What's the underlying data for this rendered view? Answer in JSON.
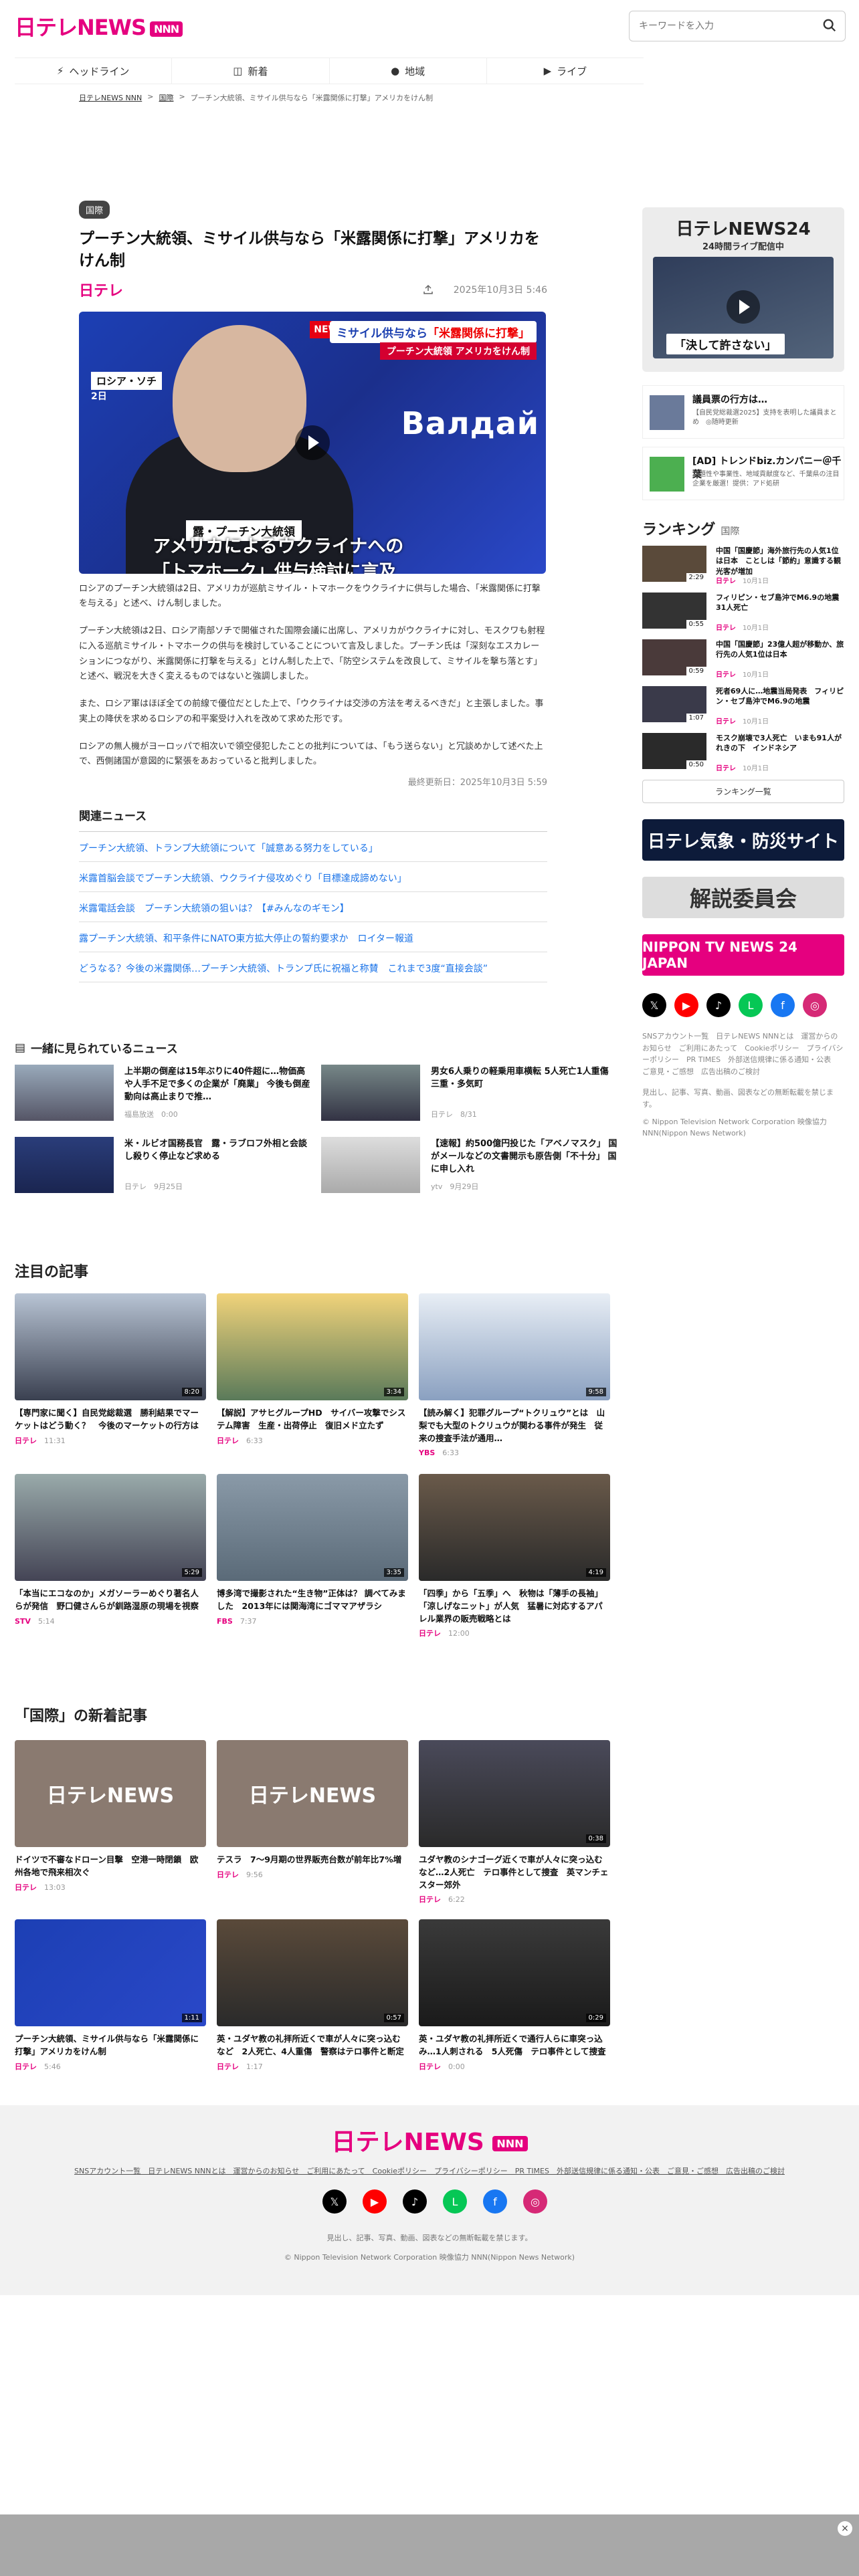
{
  "header": {
    "logo": "日テレNEWS",
    "logo_badge": "NNN",
    "search_placeholder": "キーワードを入力"
  },
  "nav": [
    {
      "label": "ヘッドライン",
      "icon": "lightning-icon"
    },
    {
      "label": "新着",
      "icon": "new-icon"
    },
    {
      "label": "地域",
      "icon": "map-pin-icon"
    },
    {
      "label": "ライブ",
      "icon": "live-icon"
    }
  ],
  "breadcrumb": [
    "日テレNEWS NNN",
    "国際",
    "プーチン大統領、ミサイル供与なら「米露関係に打撃」アメリカをけん制"
  ],
  "article": {
    "tag": "国際",
    "title": "プーチン大統領、ミサイル供与なら「米露関係に打撃」アメリカをけん制",
    "source": "日テレ",
    "date": "2025年10月3日 5:46",
    "hero": {
      "new": "NEW",
      "badge_pre": "ミサイル供与なら",
      "badge_em": "「米露関係に打撃」",
      "badge2": "プーチン大統領 アメリカをけん制",
      "place": "ロシア・ソチ",
      "day": "2日",
      "valdai": "Валдай",
      "speaker": "露・プーチン大統領",
      "cap1": "アメリカによるウクライナへの",
      "cap2": "「トマホーク」供与検討に言及"
    },
    "paragraphs": [
      "ロシアのプーチン大統領は2日、アメリカが巡航ミサイル・トマホークをウクライナに供与した場合、「米露関係に打撃を与える」と述べ、けん制しました。",
      "プーチン大統領は2日、ロシア南部ソチで開催された国際会議に出席し、アメリカがウクライナに対し、モスクワも射程に入る巡航ミサイル・トマホークの供与を検討していることについて言及しました。プーチン氏は「深刻なエスカレーションにつながり、米露関係に打撃を与える」とけん制した上で、「防空システムを改良して、ミサイルを撃ち落とす」と述べ、戦況を大きく変えるものではないと強調しました。",
      "また、ロシア軍はほぼ全ての前線で優位だとした上で、「ウクライナは交渉の方法を考えるべきだ」と主張しました。事実上の降伏を求めるロシアの和平案受け入れを改めて求めた形です。",
      "ロシアの無人機がヨーロッパで相次いで領空侵犯したことの批判については、「もう送らない」と冗談めかして述べた上で、西側諸国が意図的に緊張をあおっていると批判しました。"
    ],
    "updated": "最終更新日：2025年10月3日 5:59"
  },
  "related": {
    "heading": "関連ニュース",
    "items": [
      "プーチン大統領、トランプ大統領について「誠意ある努力をしている」",
      "米露首脳会談でプーチン大統領、ウクライナ侵攻めぐり「目標達成諦めない」",
      "米露電話会談　プーチン大統領の狙いは？【#みんなのギモン】",
      "露プーチン大統領、和平条件にNATO東方拡大停止の誓約要求か　ロイター報道",
      "どうなる？今後の米露関係…プーチン大統領、トランプ氏に祝福と称賛　これまで3度“直接会談”"
    ]
  },
  "seen": {
    "heading": "一緒に見られているニュース",
    "items": [
      {
        "title": "上半期の倒産は15年ぶりに40件超に…物価高や人手不足で多くの企業が「廃業」 今後も倒産動向は高止まりで推…",
        "source": "福島放送",
        "time": "0:00"
      },
      {
        "title": "男女6人乗りの軽乗用車横転 5人死亡1人重傷　三重・多気町",
        "source": "日テレ",
        "time": "8/31"
      },
      {
        "title": "米・ルビオ国務長官　露・ラブロフ外相と会談し殺りく停止など求める",
        "source": "日テレ",
        "time": "9月25日"
      },
      {
        "title": "【速報】約500億円投じた「アベノマスク」 国がメールなどの文書開示も原告側「不十分」 国に申し入れ",
        "source": "ytv",
        "time": "9月29日"
      }
    ]
  },
  "sidebar": {
    "live_title": "日テレNEWS24",
    "live_sub": "24時間ライブ配信中",
    "live_caption": "「決して許さない」",
    "ads": [
      {
        "title": "議員票の行方は…",
        "desc": "【自民党総裁選2025】支持を表明した議員まとめ　◎随時更新"
      },
      {
        "title": "[AD] トレンドbiz.カンパニー＠千葉",
        "desc": "話題性や事業性、地域貢献度など、千葉県の注目企業を厳選！提供：アド処研"
      }
    ],
    "ranking_heading": "ランキング",
    "ranking_tab": "国際",
    "ranking": [
      {
        "title": "中国「国慶節」海外旅行先の人気1位は日本　ことしは「節約」意識する観光客が増加",
        "src": "日テレ",
        "time": "10月1日",
        "dur": "2:29"
      },
      {
        "title": "フィリピン・セブ島沖でM6.9の地震　31人死亡",
        "src": "日テレ",
        "time": "10月1日",
        "dur": "0:55"
      },
      {
        "title": "中国「国慶節」23億人超が移動か、旅行先の人気1位は日本",
        "src": "日テレ",
        "time": "10月1日",
        "dur": "0:59"
      },
      {
        "title": "死者69人に…地震当局発表　フィリピン・セブ島沖でM6.9の地震",
        "src": "日テレ",
        "time": "10月1日",
        "dur": "1:07"
      },
      {
        "title": "モスク崩壊で3人死亡　いまも91人がれきの下　インドネシア",
        "src": "日テレ",
        "time": "10月1日",
        "dur": "0:50"
      }
    ],
    "ranking_all": "ランキング一覧",
    "banners": [
      "日テレ気象・防災サイト",
      "解説委員会",
      "NIPPON TV NEWS 24 JAPAN"
    ],
    "foot_links": "SNSアカウント一覧　日テレNEWS NNNとは　運営からのお知らせ　ご利用にあたって　Cookieポリシー　プライバシーポリシー　PR TIMES　外部送信規律に係る通知・公表　ご意見・ご感想　広告出稿のご検討",
    "foot_rights": "見出し、記事、写真、動画、図表などの無断転載を禁じます。",
    "foot_copy": "© Nippon Television Network Corporation 映像協力 NNN(Nippon News Network)"
  },
  "featured": {
    "heading": "注目の記事",
    "items": [
      {
        "title": "【専門家に聞く】自民党総裁選　勝利結果でマーケットはどう動く？　今後のマーケットの行方は",
        "source": "日テレ",
        "time": "11:31",
        "dur": "8:20"
      },
      {
        "title": "【解説】アサヒグループHD　サイバー攻撃でシステム障害　生産・出荷停止　復旧メド立たず",
        "source": "日テレ",
        "time": "6:33",
        "dur": "3:34"
      },
      {
        "title": "【読み解く】犯罪グループ“トクリュウ”とは　山梨でも大型のトクリュウが関わる事件が発生　従来の捜査手法が通用…",
        "source": "YBS",
        "time": "6:33",
        "dur": "9:58"
      },
      {
        "title": "「本当にエコなのか」メガソーラーめぐり著名人らが発信　野口健さんらが釧路湿原の現場を視察",
        "source": "STV",
        "time": "5:14",
        "dur": "5:29"
      },
      {
        "title": "博多湾で撮影された“生き物”正体は？ 調べてみました　2013年には関海湾にゴママアザラシ",
        "source": "FBS",
        "time": "7:37",
        "dur": "3:35"
      },
      {
        "title": "「四季」から「五季」へ　秋物は「薄手の長袖」「涼しげなニット」が人気　猛暑に対応するアパレル業界の販売戦略とは",
        "source": "日テレ",
        "time": "12:00",
        "dur": "4:19"
      }
    ]
  },
  "latest": {
    "heading": "「国際」の新着記事",
    "items": [
      {
        "title": "ドイツで不審なドローン目撃　空港一時閉鎖　欧州各地で飛来相次ぐ",
        "source": "日テレ",
        "time": "13:03",
        "dur": ""
      },
      {
        "title": "テスラ　7～9月期の世界販売台数が前年比7%増",
        "source": "日テレ",
        "time": "9:56",
        "dur": ""
      },
      {
        "title": "ユダヤ教のシナゴーグ近くで車が人々に突っ込むなど…2人死亡　テロ事件として捜査　英マンチェスター郊外",
        "source": "日テレ",
        "time": "6:22",
        "dur": "0:38"
      },
      {
        "title": "プーチン大統領、ミサイル供与なら「米露関係に打撃」アメリカをけん制",
        "source": "日テレ",
        "time": "5:46",
        "dur": "1:11"
      },
      {
        "title": "英・ユダヤ教の礼拝所近くで車が人々に突っ込むなど　2人死亡、4人重傷　警察はテロ事件と断定",
        "source": "日テレ",
        "time": "1:17",
        "dur": "0:57"
      },
      {
        "title": "英・ユダヤ教の礼拝所近くで通行人らに車突っ込み…1人刺される　5人死傷　テロ事件として捜査",
        "source": "日テレ",
        "time": "0:00",
        "dur": "0:29"
      }
    ]
  },
  "footer": {
    "logo": "日テレNEWS",
    "badge": "NNN"
  }
}
